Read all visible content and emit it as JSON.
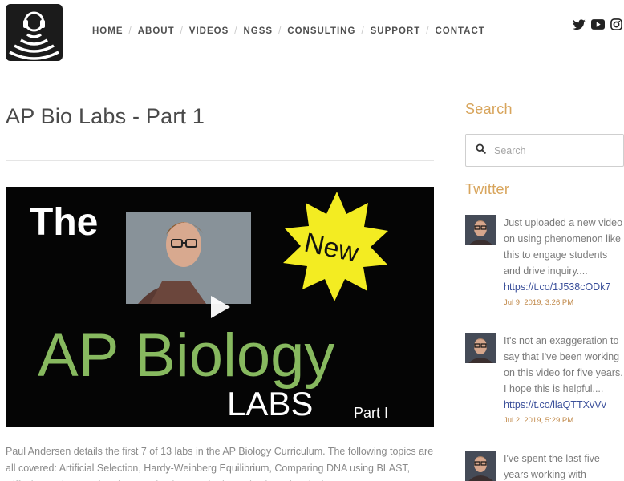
{
  "nav": {
    "items": [
      {
        "label": "HOME"
      },
      {
        "label": "ABOUT"
      },
      {
        "label": "VIDEOS"
      },
      {
        "label": "NGSS"
      },
      {
        "label": "CONSULTING"
      },
      {
        "label": "SUPPORT"
      },
      {
        "label": "CONTACT"
      }
    ],
    "separator": "/"
  },
  "social": {
    "icons": [
      "twitter-icon",
      "youtube-icon",
      "instagram-icon"
    ]
  },
  "post": {
    "title": "AP Bio Labs - Part 1",
    "video": {
      "line1": "The",
      "badge": "New",
      "line2": "AP Biology",
      "line3": "LABS",
      "part": "Part I"
    },
    "description": "Paul Andersen details the first 7 of 13 labs in the AP Biology Curriculum. The following topics are all covered: Artificial Selection, Hardy-Weinberg Equilibrium, Comparing DNA using BLAST, Diffusion and Osmosis, Photosynthesis, Respiration, Mitosis and Meiosis."
  },
  "sidebar": {
    "search_title": "Search",
    "search_placeholder": "Search",
    "twitter_title": "Twitter",
    "tweets": [
      {
        "text": "Just uploaded a new video on using phenomenon like this to engage students and drive inquiry....",
        "link": "https://t.co/1J538cODk7",
        "date": "Jul 9, 2019, 3:26 PM"
      },
      {
        "text": "It's not an exaggeration to say that I've been working on this video for five years. I hope this is helpful....",
        "link": "https://t.co/llaQTTXvVv",
        "date": "Jul 2, 2019, 5:29 PM"
      },
      {
        "text": "I've spent the last five years working with",
        "link": "",
        "date": ""
      }
    ]
  }
}
